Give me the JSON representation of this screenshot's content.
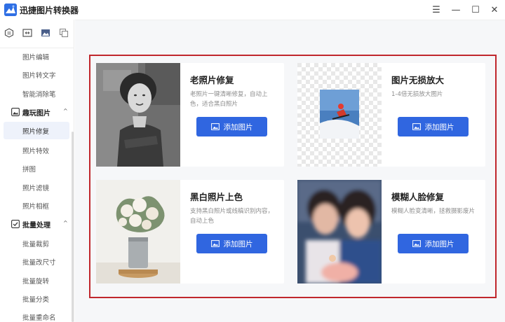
{
  "app": {
    "title": "迅捷图片转换器"
  },
  "window_controls": {
    "menu": "☰",
    "minimize": "—",
    "maximize": "☐",
    "close": "✕"
  },
  "sidebar": {
    "top_icons": [
      "document-icon",
      "resize-icon",
      "image-icon",
      "copy-icon"
    ],
    "items_before": [
      "图片编辑",
      "图片转文字",
      "智能消除笔"
    ],
    "groups": [
      {
        "label": "趣玩图片",
        "icon": "picture-frame-icon",
        "expanded": true,
        "items": [
          "照片修复",
          "照片特效",
          "拼图",
          "照片滤镜",
          "照片相框"
        ],
        "active_index": 0
      },
      {
        "label": "批量处理",
        "icon": "batch-icon",
        "expanded": true,
        "items": [
          "批量裁剪",
          "批量改尺寸",
          "批量旋转",
          "批量分类",
          "批量重命名"
        ]
      }
    ]
  },
  "cards": [
    {
      "title": "老照片修复",
      "desc": "老照片一键清晰修复，自动上色，适合黑白照片",
      "button": "添加图片",
      "thumb": "old-photo-portrait"
    },
    {
      "title": "图片无损放大",
      "desc": "1-4倍无损放大图片",
      "button": "添加图片",
      "thumb": "snowboarder-transparent"
    },
    {
      "title": "黑白照片上色",
      "desc": "支持黑白照片或线稿识别内容，自动上色",
      "button": "添加图片",
      "thumb": "flower-vase"
    },
    {
      "title": "模糊人脸修复",
      "desc": "模糊人脸变清晰，拯救摄影废片",
      "button": "添加图片",
      "thumb": "blurry-couple"
    }
  ],
  "colors": {
    "accent": "#3066e0",
    "frame": "#c0272d",
    "active_bg": "#eef2fb"
  }
}
